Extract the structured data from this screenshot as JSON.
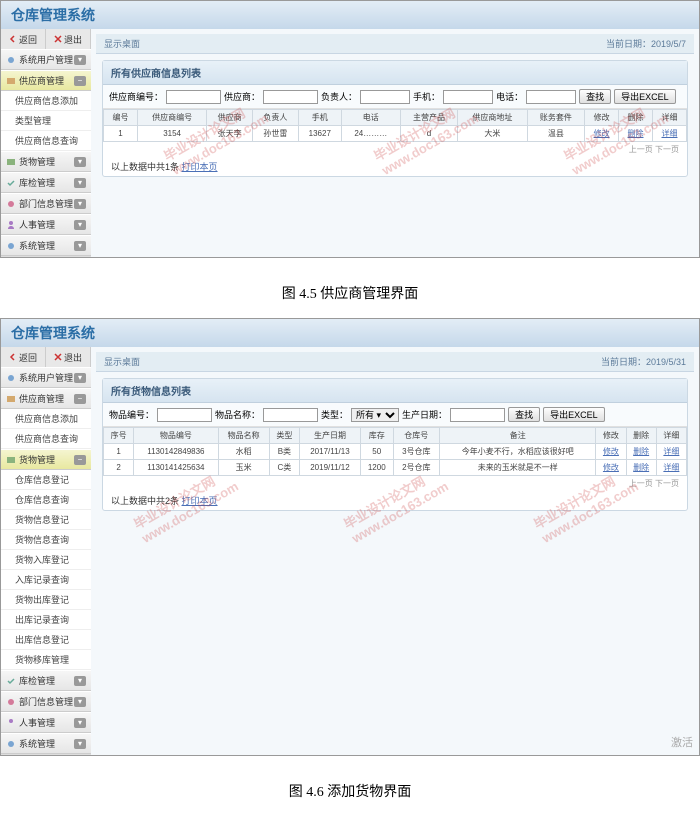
{
  "app_title": "仓库管理系统",
  "top_nav": {
    "back": "返回",
    "exit": "退出"
  },
  "sidebar_groups": [
    {
      "label": "系统用户管理"
    },
    {
      "label": "供应商管理"
    },
    {
      "label": "货物管理"
    },
    {
      "label": "库检管理"
    },
    {
      "label": "部门信息管理"
    },
    {
      "label": "人事管理"
    },
    {
      "label": "系统管理"
    }
  ],
  "supplier_sidebar_items": [
    "供应商信息添加",
    "类型管理",
    "供应商信息查询"
  ],
  "goods_sidebar_supplier": [
    "供应商信息添加",
    "供应商信息查询"
  ],
  "goods_sidebar_goods": [
    "仓库信息登记",
    "仓库信息查询",
    "货物信息登记",
    "货物信息查询",
    "货物入库登记",
    "入库记录查询",
    "货物出库登记",
    "出库记录查询",
    "出库信息登记",
    "货物移库管理"
  ],
  "breadcrumb": {
    "label": "显示桌面",
    "date_prefix": "当前日期：",
    "date1": "2019/5/7",
    "date2": "2019/5/31"
  },
  "screen1": {
    "panel_title": "所有供应商信息列表",
    "search": {
      "l1": "供应商编号：",
      "l2": "供应商：",
      "l3": "负责人：",
      "l4": "手机：",
      "l5": "电话：",
      "btn_search": "查找",
      "btn_export": "导出EXCEL"
    },
    "columns": [
      "编号",
      "供应商编号",
      "供应商",
      "负责人",
      "手机",
      "电话",
      "主营产品",
      "供应商地址",
      "账务套件",
      "修改",
      "删除",
      "详细"
    ],
    "rows": [
      [
        "1",
        "3154",
        "张天李",
        "孙世雷",
        "13627",
        "24………",
        "d",
        "大米",
        "温县",
        "修改",
        "删除",
        "详细"
      ]
    ],
    "pager": "上一页 下一页",
    "footer": "以上数据中共1条 ",
    "print": "打印本页"
  },
  "caption1": "图 4.5 供应商管理界面",
  "screen2": {
    "panel_title": "所有货物信息列表",
    "search": {
      "l1": "物品编号：",
      "l2": "物品名称：",
      "l3": "类型：",
      "sel": "所有 ▾",
      "l4": "生产日期：",
      "btn_search": "查找",
      "btn_export": "导出EXCEL"
    },
    "columns": [
      "序号",
      "物品编号",
      "物品名称",
      "类型",
      "生产日期",
      "库存",
      "仓库号",
      "备注",
      "修改",
      "删除",
      "详细"
    ],
    "rows": [
      [
        "1",
        "1130142849836",
        "水稻",
        "B类",
        "2017/11/13",
        "50",
        "3号仓库",
        "今年小麦不行，水稻应该很好吧",
        "修改",
        "删除",
        "详细"
      ],
      [
        "2",
        "1130141425634",
        "玉米",
        "C类",
        "2019/11/12",
        "1200",
        "2号仓库",
        "未来的玉米就是不一样",
        "修改",
        "删除",
        "详细"
      ]
    ],
    "pager": "上一页 下一页",
    "footer": "以上数据中共2条 ",
    "print": "打印本页"
  },
  "caption2": "图 4.6 添加货物界面",
  "activate": "激活",
  "watermark_line1": "毕业设计论文网",
  "watermark_line2": "www.doc163.com"
}
